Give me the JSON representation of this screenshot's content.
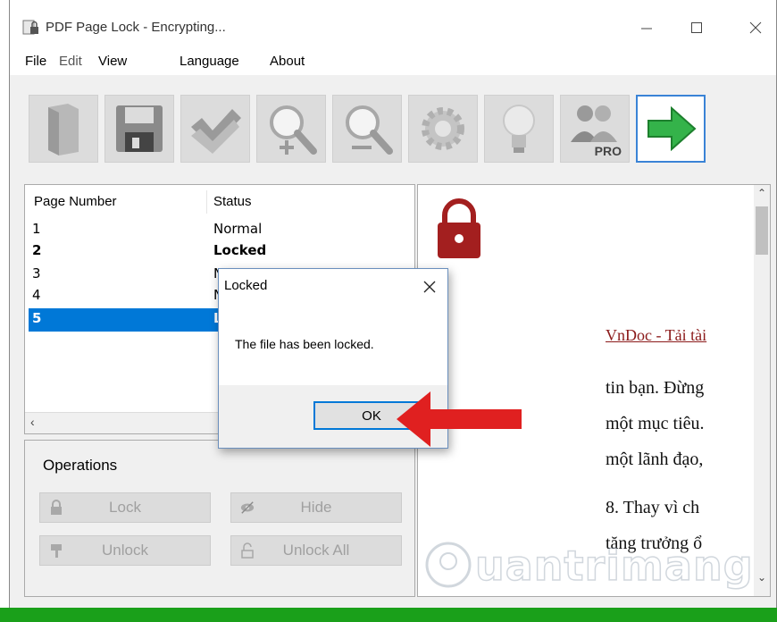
{
  "window": {
    "title": "PDF Page Lock - Encrypting..."
  },
  "menu": [
    "File",
    "Edit",
    "View",
    "Language",
    "About"
  ],
  "toolbar": {
    "buttons": [
      {
        "name": "open-icon"
      },
      {
        "name": "save-icon"
      },
      {
        "name": "check-all-icon"
      },
      {
        "name": "zoom-in-icon"
      },
      {
        "name": "zoom-out-icon"
      },
      {
        "name": "settings-icon"
      },
      {
        "name": "lightbulb-icon"
      },
      {
        "name": "pro-users-icon",
        "label": "PRO"
      },
      {
        "name": "go-arrow-icon"
      }
    ]
  },
  "page_list": {
    "columns": [
      "Page Number",
      "Status"
    ],
    "rows": [
      {
        "page": "1",
        "status": "Normal"
      },
      {
        "page": "2",
        "status": "Locked"
      },
      {
        "page": "3",
        "status": "N"
      },
      {
        "page": "4",
        "status": "N"
      },
      {
        "page": "5",
        "status": "L"
      }
    ]
  },
  "operations": {
    "title": "Operations",
    "lock": "Lock",
    "hide": "Hide",
    "unlock": "Unlock",
    "unlock_all": "Unlock All"
  },
  "preview": {
    "link_text": "VnDoc - Tải tài",
    "lines": [
      "tin bạn. Đừng",
      "một mục tiêu.",
      "một lãnh đạo,",
      "8. Thay vì ch",
      "tăng trưởng ổ"
    ]
  },
  "dialog": {
    "title": "Locked",
    "message": "The file has been locked.",
    "ok": "OK"
  },
  "watermark": "uantrimang",
  "colors": {
    "accent": "#0078d7",
    "lock_red": "#a31f1f",
    "arrow_red": "#e02020",
    "status_green": "#1aa01a"
  }
}
